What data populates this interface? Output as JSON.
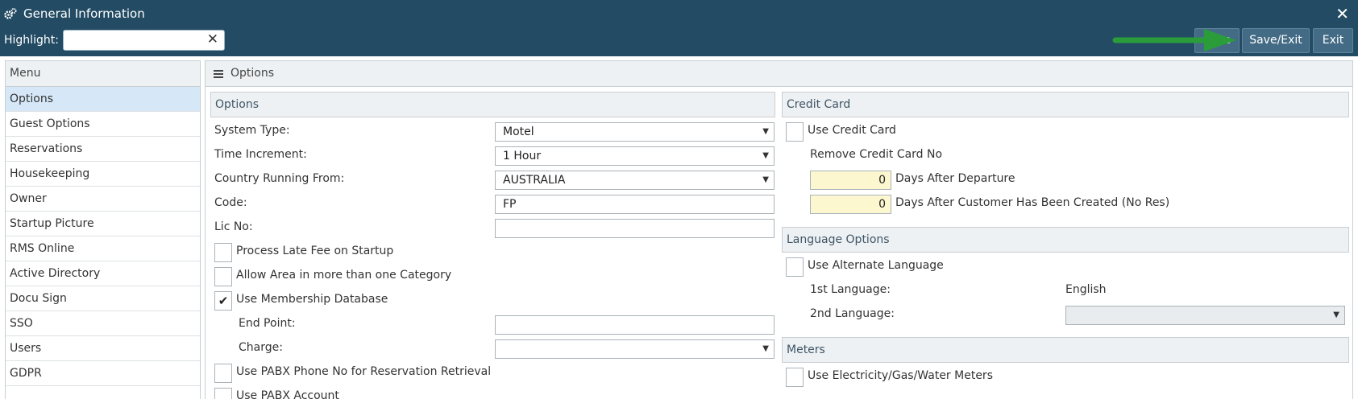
{
  "window": {
    "title": "General Information",
    "close_glyph": "✕"
  },
  "toolbar": {
    "highlight_label": "Highlight:",
    "highlight_value": "",
    "clear_glyph": "✕",
    "save_label": "Save",
    "save_exit_label": "Save/Exit",
    "exit_label": "Exit",
    "annotation_arrow_color": "#2a9d3a"
  },
  "sidebar": {
    "title": "Menu",
    "items": [
      {
        "label": "Options",
        "active": true
      },
      {
        "label": "Guest Options"
      },
      {
        "label": "Reservations"
      },
      {
        "label": "Housekeeping"
      },
      {
        "label": "Owner"
      },
      {
        "label": "Startup Picture"
      },
      {
        "label": "RMS Online"
      },
      {
        "label": "Active Directory"
      },
      {
        "label": "Docu Sign"
      },
      {
        "label": "SSO"
      },
      {
        "label": "Users"
      },
      {
        "label": "GDPR"
      }
    ]
  },
  "main": {
    "title": "Options",
    "options": {
      "title": "Options",
      "system_type": {
        "label": "System Type:",
        "value": "Motel"
      },
      "time_increment": {
        "label": "Time Increment:",
        "value": "1 Hour"
      },
      "country": {
        "label": "Country Running From:",
        "value": "AUSTRALIA"
      },
      "code": {
        "label": "Code:",
        "value": "FP"
      },
      "lic_no": {
        "label": "Lic No:",
        "value": ""
      },
      "process_late_fee": {
        "label": "Process Late Fee on Startup",
        "checked": false
      },
      "allow_area": {
        "label": "Allow Area in more than one Category",
        "checked": false
      },
      "use_membership": {
        "label": "Use Membership Database",
        "checked": true,
        "check_glyph": "✔"
      },
      "end_point": {
        "label": "End Point:",
        "value": ""
      },
      "charge": {
        "label": "Charge:",
        "value": ""
      },
      "use_pabx_phone": {
        "label": "Use PABX Phone No for Reservation Retrieval",
        "checked": false
      },
      "use_pabx_account": {
        "label": "Use PABX Account",
        "checked": false
      }
    },
    "credit_card": {
      "title": "Credit Card",
      "use_credit_card": {
        "label": "Use Credit Card",
        "checked": false
      },
      "remove_label": "Remove Credit Card No",
      "days_after_departure": {
        "value": "0",
        "label": "Days After Departure"
      },
      "days_after_created": {
        "value": "0",
        "label": "Days After Customer Has Been Created (No Res)"
      }
    },
    "language": {
      "title": "Language Options",
      "use_alternate": {
        "label": "Use Alternate Language",
        "checked": false
      },
      "first_label": "1st Language:",
      "first_value": "English",
      "second_label": "2nd Language:",
      "second_value": ""
    },
    "meters": {
      "title": "Meters",
      "use_meters": {
        "label": "Use Electricity/Gas/Water Meters",
        "checked": false
      }
    }
  }
}
